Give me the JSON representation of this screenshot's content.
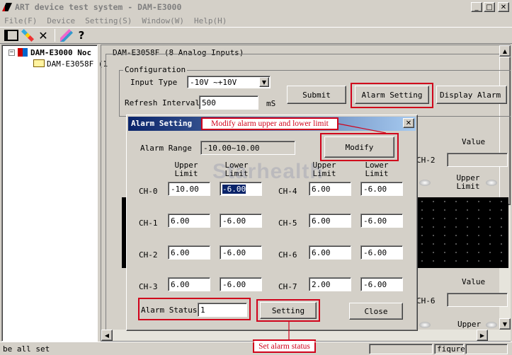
{
  "window": {
    "title": "ART device test system - DAM-E3000",
    "menu": [
      "File(F)",
      "Device",
      "Setting(S)",
      "Window(W)",
      "Help(H)"
    ],
    "min": "_",
    "max": "□",
    "close": "✕"
  },
  "tree": {
    "root": "DAM-E3000 Noc",
    "child": "DAM-E3058F (1",
    "expander": "−"
  },
  "panel": {
    "title": "DAM-E3058F (8 Analog Inputs)",
    "config_label": "Configuration",
    "input_type_label": "Input Type",
    "input_type_value": "-10V ~+10V",
    "refresh_label": "Refresh Interval",
    "refresh_value": "500",
    "refresh_unit": "mS",
    "submit": "Submit",
    "alarm_setting": "Alarm Setting",
    "display_alarm": "Display Alarm",
    "value_label_1": "Value",
    "ch2_label": "CH-2",
    "upper_limit_1": "Upper Limit",
    "value_label_2": "Value",
    "ch6_label": "CH-6",
    "upper_limit_2": "Upper"
  },
  "dialog": {
    "title": "Alarm Setting",
    "alarm_range_label": "Alarm Range",
    "alarm_range_value": "-10.00~10.00",
    "modify": "Modify",
    "upper_limit": "Upper Limit",
    "lower_limit": "Lower Limit",
    "channels_left": [
      {
        "label": "CH-0",
        "upper": "-10.00",
        "lower": "-6.00"
      },
      {
        "label": "CH-1",
        "upper": "6.00",
        "lower": "-6.00"
      },
      {
        "label": "CH-2",
        "upper": "6.00",
        "lower": "-6.00"
      },
      {
        "label": "CH-3",
        "upper": "6.00",
        "lower": "-6.00"
      }
    ],
    "channels_right": [
      {
        "label": "CH-4",
        "upper": "6.00",
        "lower": "-6.00"
      },
      {
        "label": "CH-5",
        "upper": "6.00",
        "lower": "-6.00"
      },
      {
        "label": "CH-6",
        "upper": "6.00",
        "lower": "-6.00"
      },
      {
        "label": "CH-7",
        "upper": "2.00",
        "lower": "-6.00"
      }
    ],
    "alarm_status_label": "Alarm Status",
    "alarm_status_value": "1",
    "setting": "Setting",
    "close": "Close",
    "close_x": "✕"
  },
  "annotations": {
    "modify_note": "Modify alarm upper and lower limit",
    "setting_note": "Set alarm status"
  },
  "statusbar": {
    "left": "be all set",
    "right": "fiqure"
  },
  "watermark": "Starhealth Production"
}
